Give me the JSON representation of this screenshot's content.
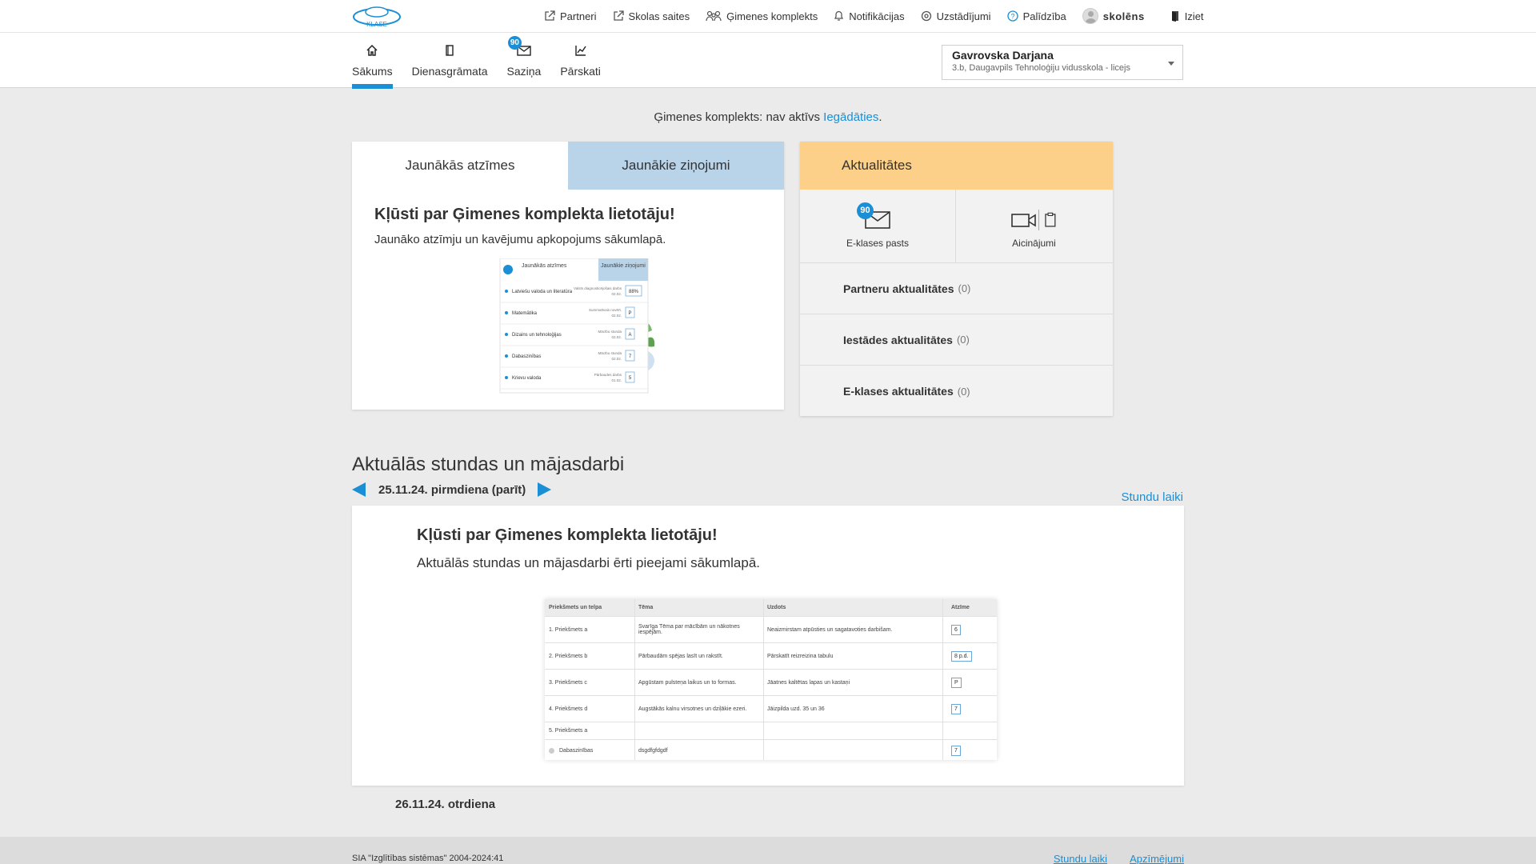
{
  "colors": {
    "accent": "#1a8fd6",
    "tab_inactive": "#b9d3e8",
    "news_header": "#fdd08a",
    "page_bg": "#ebebeb"
  },
  "brand": {
    "logo_text": "KLASE"
  },
  "topnav": {
    "partners": "Partneri",
    "school_links": "Skolas saites",
    "family_kit": "Ģimenes komplekts",
    "notifications": "Notifikācijas",
    "settings": "Uzstādījumi",
    "help": "Palīdzība",
    "user": "skolēns",
    "logout": "Iziet"
  },
  "tabs": [
    {
      "label": "Sākums",
      "icon": "home-icon",
      "active": true
    },
    {
      "label": "Dienasgrāmata",
      "icon": "diary-icon"
    },
    {
      "label": "Saziņa",
      "icon": "mail-icon",
      "badge": "90"
    },
    {
      "label": "Pārskati",
      "icon": "chart-icon"
    }
  ],
  "student": {
    "name": "Gavrovska Darjana",
    "school": "3.b, Daugavpils Tehnoloģiju vidusskola - licejs"
  },
  "family_notice": {
    "text": "Ģimenes komplekts: nav aktīvs",
    "link": "Iegādāties",
    "end": "."
  },
  "left_panel": {
    "tab_grades": "Jaunākās atzīmes",
    "tab_messages": "Jaunākie ziņojumi",
    "promo_title": "Kļūsti par Ģimenes komplekta lietotāju!",
    "promo_sub": "Jaunāko atzīmju un kavējumu apkopojums sākumlapā.",
    "preview": {
      "tab_a": "Jaunākās atzīmes",
      "tab_b": "Jaunākie ziņojumi",
      "rows": [
        {
          "subject": "Latviešu valoda un literatūra",
          "type": "Valsts diagnosticējošais darbs",
          "date": "02.02.",
          "grade": "88%"
        },
        {
          "subject": "Matemātika",
          "type": "Summatīvais novērt.",
          "date": "02.02.",
          "grade": "P"
        },
        {
          "subject": "Dizains un tehnoloģijas",
          "type": "Mācību stunda",
          "date": "02.02.",
          "grade": "A"
        },
        {
          "subject": "Dabaszinības",
          "type": "Mācību stunda",
          "date": "02.02.",
          "grade": "7"
        },
        {
          "subject": "Krievu valoda",
          "type": "Pārbaudes darbs",
          "date": "01.02.",
          "grade": "5"
        }
      ]
    }
  },
  "right_panel": {
    "header": "Aktualitātes",
    "email_label": "E-klases pasts",
    "email_badge": "90",
    "invites_label": "Aicinājumi",
    "rows": [
      {
        "label": "Partneru aktualitātes",
        "count": "(0)"
      },
      {
        "label": "Iestādes aktualitātes",
        "count": "(0)"
      },
      {
        "label": "E-klases aktualitātes",
        "count": "(0)"
      }
    ]
  },
  "lessons": {
    "title": "Aktuālās stundas un mājasdarbi",
    "date": "25.11.24. pirmdiena (parīt)",
    "times_link": "Stundu laiki",
    "promo_title": "Kļūsti par Ģimenes komplekta lietotāju!",
    "promo_sub": "Aktuālās stundas un mājasdarbi ērti pieejami sākumlapā.",
    "table": {
      "headers": [
        "Priekšmets un telpa",
        "Tēma",
        "Uzdots",
        "Atzīme"
      ],
      "rows": [
        {
          "subject": "1.  Priekšmets a",
          "topic": "Svarīga Tēma par mācībām un nākotnes iespējām.",
          "task": "Neaizmirstam atpūsties un sagatavoties darbišam.",
          "grade": "6"
        },
        {
          "subject": "2.  Priekšmets b",
          "topic": "Pārbaudām spējas lasīt un rakstīt.",
          "task": "Pārskatīt reizreizina tabulu",
          "grade": "8 p.d."
        },
        {
          "subject": "3.  Priekšmets c",
          "topic": "Apgūstam pulsteņa laikus un to formas.",
          "task": "Jāatnes kaltētas lapas un kastaņi",
          "grade": "P"
        },
        {
          "subject": "4.  Priekšmets d",
          "topic": "Augstākās kalnu virsotnes un dziļākie ezeri.",
          "task": "Jāizpilda uzd. 35 un 36",
          "grade": "7"
        },
        {
          "subject": "5.  Priekšmets a",
          "topic": "",
          "task": "",
          "grade": ""
        },
        {
          "subject": "Dabaszinības",
          "topic": "dsgdfgfdgdf",
          "task": "",
          "grade": "7"
        }
      ]
    },
    "next_date": "26.11.24. otrdiena"
  },
  "footer": {
    "copyright": "SIA \"Izglītības sistēmas\" 2004-2024:41",
    "link_times": "Stundu laiki",
    "link_legend": "Apzīmējumi"
  }
}
